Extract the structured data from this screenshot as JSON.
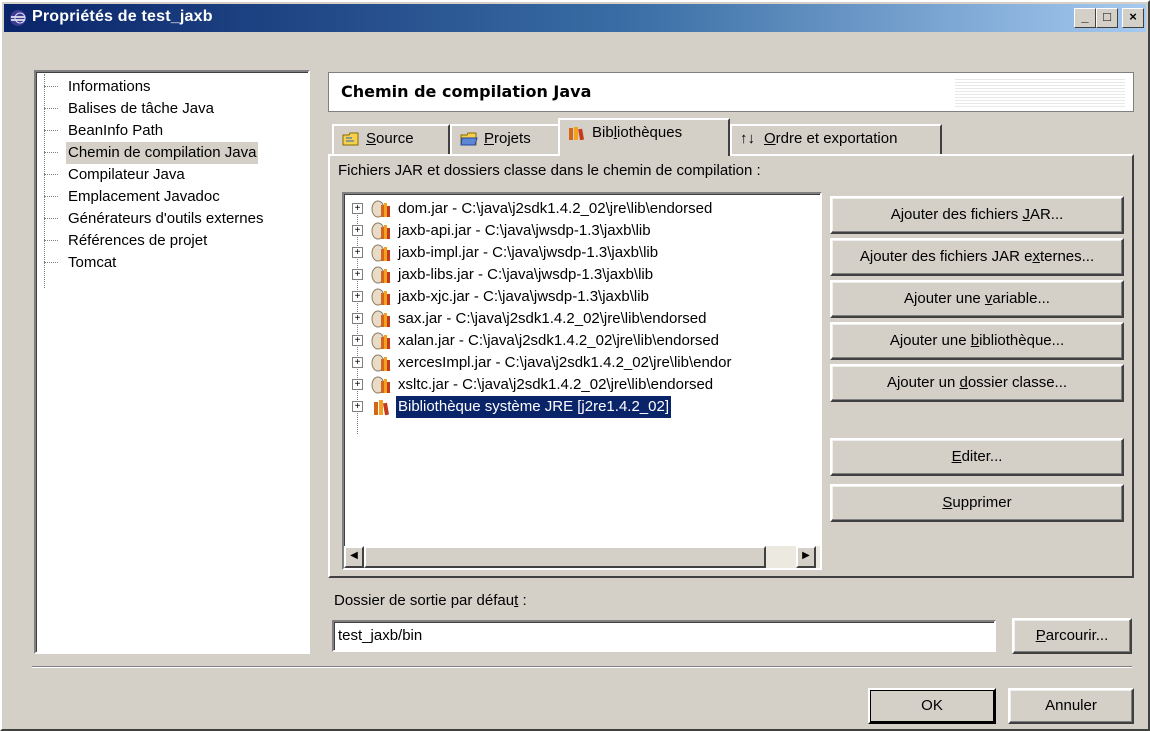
{
  "window": {
    "title": "Propriétés de test_jaxb",
    "controls": [
      "_",
      "□",
      "×"
    ]
  },
  "nav": {
    "items": [
      {
        "label": "Informations"
      },
      {
        "label": "Balises de tâche Java"
      },
      {
        "label": "BeanInfo Path"
      },
      {
        "label": "Chemin de compilation Java",
        "selected": true
      },
      {
        "label": "Compilateur Java"
      },
      {
        "label": "Emplacement Javadoc"
      },
      {
        "label": "Générateurs d'outils externes"
      },
      {
        "label": "Références de projet"
      },
      {
        "label": "Tomcat"
      }
    ]
  },
  "header": {
    "title": "Chemin de compilation Java"
  },
  "tabs": [
    {
      "pre": "",
      "u": "S",
      "post": "ource",
      "icon": "folder-source-icon"
    },
    {
      "pre": "",
      "u": "P",
      "post": "rojets",
      "icon": "folder-projects-icon"
    },
    {
      "pre": "Bib",
      "u": "l",
      "post": "iothèques",
      "icon": "library-icon",
      "active": true
    },
    {
      "pre": "",
      "u": "O",
      "post": "rdre et exportation",
      "icon": "order-arrows-icon"
    }
  ],
  "panel": {
    "label": "Fichiers JAR et dossiers classe dans le chemin de compilation :"
  },
  "libraries": [
    {
      "label": "dom.jar - C:\\java\\j2sdk1.4.2_02\\jre\\lib\\endorsed"
    },
    {
      "label": "jaxb-api.jar - C:\\java\\jwsdp-1.3\\jaxb\\lib"
    },
    {
      "label": "jaxb-impl.jar - C:\\java\\jwsdp-1.3\\jaxb\\lib"
    },
    {
      "label": "jaxb-libs.jar - C:\\java\\jwsdp-1.3\\jaxb\\lib"
    },
    {
      "label": "jaxb-xjc.jar - C:\\java\\jwsdp-1.3\\jaxb\\lib"
    },
    {
      "label": "sax.jar - C:\\java\\j2sdk1.4.2_02\\jre\\lib\\endorsed"
    },
    {
      "label": "xalan.jar - C:\\java\\j2sdk1.4.2_02\\jre\\lib\\endorsed"
    },
    {
      "label": "xercesImpl.jar - C:\\java\\j2sdk1.4.2_02\\jre\\lib\\endor"
    },
    {
      "label": "xsltc.jar - C:\\java\\j2sdk1.4.2_02\\jre\\lib\\endorsed"
    },
    {
      "label": "Bibliothèque système JRE [j2re1.4.2_02]",
      "selected": true
    }
  ],
  "buttons": {
    "add_jar": {
      "pre": "Ajouter des fichiers ",
      "u": "J",
      "post": "AR..."
    },
    "add_ext_jar": {
      "pre": "Ajouter des fichiers JAR e",
      "u": "x",
      "post": "ternes..."
    },
    "add_variable": {
      "pre": "Ajouter une ",
      "u": "v",
      "post": "ariable..."
    },
    "add_library": {
      "pre": "Ajouter une ",
      "u": "b",
      "post": "ibliothèque..."
    },
    "add_class_folder": {
      "pre": "Ajouter un ",
      "u": "d",
      "post": "ossier classe..."
    },
    "edit": {
      "pre": "",
      "u": "E",
      "post": "diter..."
    },
    "remove": {
      "pre": "",
      "u": "S",
      "post": "upprimer"
    },
    "browse": {
      "pre": "",
      "u": "P",
      "post": "arcourir..."
    },
    "ok": "OK",
    "cancel": "Annuler"
  },
  "output": {
    "label_pre": "Dossier de sortie par défau",
    "label_u": "t",
    "label_post": " :",
    "value": "test_jaxb/bin"
  }
}
